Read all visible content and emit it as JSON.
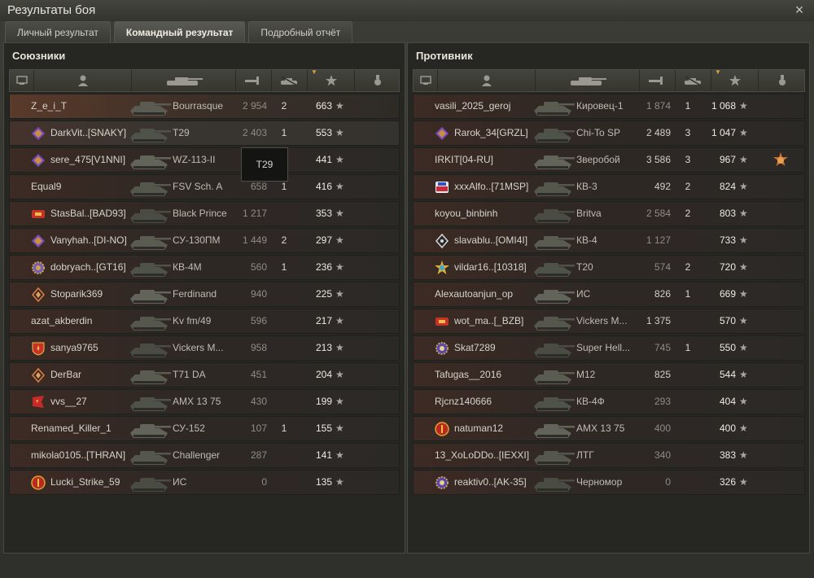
{
  "window": {
    "title": "Результаты боя",
    "close_glyph": "×"
  },
  "tabs": [
    {
      "label": "Личный результат",
      "active": false
    },
    {
      "label": "Командный результат",
      "active": true
    },
    {
      "label": "Подробный отчёт",
      "active": false
    }
  ],
  "tooltip": {
    "text": "T29"
  },
  "allies": {
    "title": "Союзники",
    "rows": [
      {
        "name": "Z_e_i_T",
        "tank": "Bourrasque",
        "damage": "2 954",
        "kills": "2",
        "xp": "663",
        "clan": "",
        "me": true
      },
      {
        "name": "DarkVit..[SNAKY]",
        "tank": "T29",
        "damage": "2 403",
        "kills": "1",
        "xp": "553",
        "clan": "purple-diamond",
        "hl": true
      },
      {
        "name": "sere_475[V1NNI]",
        "tank": "WZ-113-II",
        "damage": "",
        "kills": "",
        "xp": "441",
        "clan": "purple-diamond"
      },
      {
        "name": "Equal9",
        "tank": "FSV Sch. A",
        "damage": "658",
        "kills": "1",
        "xp": "416",
        "clan": ""
      },
      {
        "name": "StasBal..[BAD93]",
        "tank": "Black Prince",
        "damage": "1 217",
        "kills": "",
        "xp": "353",
        "clan": "red-badge"
      },
      {
        "name": "Vanyhah..[DI-NO]",
        "tank": "СУ-130ПМ",
        "damage": "1 449",
        "kills": "2",
        "xp": "297",
        "clan": "purple-diamond"
      },
      {
        "name": "dobryach..[GT16]",
        "tank": "КВ-4М",
        "damage": "560",
        "kills": "1",
        "xp": "236",
        "clan": "gold-gear"
      },
      {
        "name": "Stoparik369",
        "tank": "Ferdinand",
        "damage": "940",
        "kills": "",
        "xp": "225",
        "clan": "orange-diamond"
      },
      {
        "name": "azat_akberdin",
        "tank": "Kv fm/49",
        "damage": "596",
        "kills": "",
        "xp": "217",
        "clan": ""
      },
      {
        "name": "sanya9765",
        "tank": "Vickers M...",
        "damage": "958",
        "kills": "",
        "xp": "213",
        "clan": "red-shield"
      },
      {
        "name": "DerBar",
        "tank": "T71 DA",
        "damage": "451",
        "kills": "",
        "xp": "204",
        "clan": "orange-diamond"
      },
      {
        "name": "vvs__27",
        "tank": "AMX 13 75",
        "damage": "430",
        "kills": "",
        "xp": "199",
        "clan": "red-flag"
      },
      {
        "name": "Renamed_Killer_1",
        "tank": "СУ-152",
        "damage": "107",
        "kills": "1",
        "xp": "155",
        "clan": ""
      },
      {
        "name": "mikola0105..[THRAN]",
        "tank": "Challenger",
        "damage": "287",
        "kills": "",
        "xp": "141",
        "clan": ""
      },
      {
        "name": "Lucki_Strike_59",
        "tank": "ИС",
        "damage": "0",
        "kills": "",
        "xp": "135",
        "clan": "red-round"
      }
    ]
  },
  "enemies": {
    "title": "Противник",
    "rows": [
      {
        "name": "vasili_2025_geroj",
        "tank": "Кировец-1",
        "damage": "1 874",
        "kills": "1",
        "xp": "1 068",
        "clan": ""
      },
      {
        "name": "Rarok_34[GRZL]",
        "tank": "Chi-To SP",
        "damage": "2 489",
        "kills": "3",
        "xp": "1 047",
        "clan": "purple-diamond",
        "bright": true
      },
      {
        "name": "IRKIT[04-RU]",
        "tank": "Зверобой",
        "damage": "3 586",
        "kills": "3",
        "xp": "967",
        "clan": "",
        "bright": true,
        "medal": true
      },
      {
        "name": "xxxAlfo..[71MSP]",
        "tank": "КВ-3",
        "damage": "492",
        "kills": "2",
        "xp": "824",
        "clan": "blue-badge",
        "bright": true
      },
      {
        "name": "koyou_binbinh",
        "tank": "Britva",
        "damage": "2 584",
        "kills": "2",
        "xp": "803",
        "clan": ""
      },
      {
        "name": "slavablu..[OMI4I]",
        "tank": "КВ-4",
        "damage": "1 127",
        "kills": "",
        "xp": "733",
        "clan": "white-diamond"
      },
      {
        "name": "vildar16..[10318]",
        "tank": "T20",
        "damage": "574",
        "kills": "2",
        "xp": "720",
        "clan": "gold-star"
      },
      {
        "name": "Alexautoanjun_op",
        "tank": "ИС",
        "damage": "826",
        "kills": "1",
        "xp": "669",
        "clan": "",
        "bright": true
      },
      {
        "name": "wot_ma..[_BZB]",
        "tank": "Vickers M...",
        "damage": "1 375",
        "kills": "",
        "xp": "570",
        "clan": "red-badge",
        "bright": true
      },
      {
        "name": "Skat7289",
        "tank": "Super Hell...",
        "damage": "745",
        "kills": "1",
        "xp": "550",
        "clan": "purple-gear"
      },
      {
        "name": "Tafugas__2016",
        "tank": "M12",
        "damage": "825",
        "kills": "",
        "xp": "544",
        "clan": "",
        "bright": true
      },
      {
        "name": "Rjcnz140666",
        "tank": "КВ-4Ф",
        "damage": "293",
        "kills": "",
        "xp": "404",
        "clan": ""
      },
      {
        "name": "natuman12",
        "tank": "AMX 13 75",
        "damage": "400",
        "kills": "",
        "xp": "400",
        "clan": "red-round"
      },
      {
        "name": "13_XoLoDDo..[IEXXI]",
        "tank": "ЛТГ",
        "damage": "340",
        "kills": "",
        "xp": "383",
        "clan": ""
      },
      {
        "name": "reaktiv0..[AK-35]",
        "tank": "Черномор",
        "damage": "0",
        "kills": "",
        "xp": "326",
        "clan": "purple-gear"
      }
    ]
  },
  "colors": {
    "bg": "#2a2a26",
    "row_warm": "#3d2a24",
    "accent_purple": "#8a5cc8",
    "accent_red": "#c8302a",
    "accent_gold": "#d8a040"
  }
}
